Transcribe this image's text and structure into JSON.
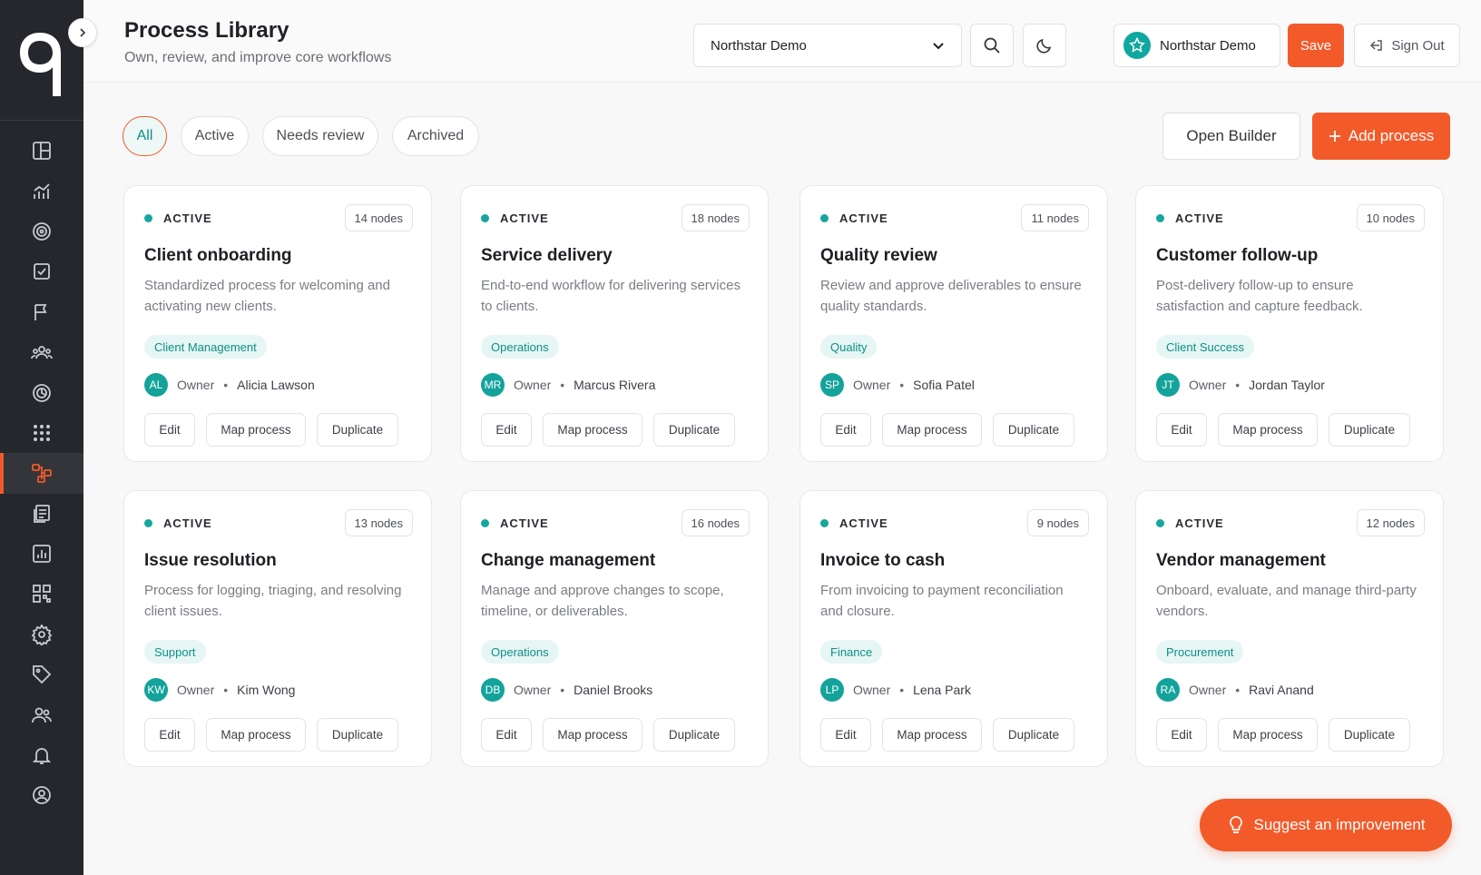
{
  "header": {
    "title": "Process Library",
    "subtitle": "Own, review, and improve core workflows",
    "workspace_select": "Northstar Demo",
    "org_name": "Northstar Demo",
    "save_label": "Save",
    "signout_label": "Sign Out"
  },
  "filters": [
    "All",
    "Active",
    "Needs review",
    "Archived"
  ],
  "active_filter": "All",
  "actions": {
    "open_builder": "Open Builder",
    "add_process": "Add process"
  },
  "sidebar": {
    "items": [
      {
        "icon": "dashboard-icon"
      },
      {
        "icon": "analytics-icon"
      },
      {
        "icon": "target-icon"
      },
      {
        "icon": "checklist-icon"
      },
      {
        "icon": "flag-icon"
      },
      {
        "icon": "team-icon"
      },
      {
        "icon": "goals-icon"
      },
      {
        "icon": "apps-icon"
      },
      {
        "icon": "process-icon",
        "active": true
      },
      {
        "icon": "documents-icon"
      },
      {
        "icon": "reports-icon"
      },
      {
        "icon": "integrations-icon"
      },
      {
        "icon": "settings-icon"
      },
      {
        "icon": "tag-icon"
      },
      {
        "icon": "users-icon"
      },
      {
        "icon": "bell-icon"
      },
      {
        "icon": "profile-icon"
      }
    ]
  },
  "card_actions": {
    "edit": "Edit",
    "map": "Map process",
    "duplicate": "Duplicate"
  },
  "owner_label": "Owner",
  "bullet": "•",
  "cards": [
    {
      "status": "ACTIVE",
      "nodes": "14 nodes",
      "name": "Client onboarding",
      "desc": "Standardized process for welcoming and activating new clients.",
      "tag": "Client Management",
      "initials": "AL",
      "owner": "Alicia Lawson"
    },
    {
      "status": "ACTIVE",
      "nodes": "18 nodes",
      "name": "Service delivery",
      "desc": "End-to-end workflow for delivering services to clients.",
      "tag": "Operations",
      "initials": "MR",
      "owner": "Marcus Rivera"
    },
    {
      "status": "ACTIVE",
      "nodes": "11 nodes",
      "name": "Quality review",
      "desc": "Review and approve deliverables to ensure quality standards.",
      "tag": "Quality",
      "initials": "SP",
      "owner": "Sofia Patel"
    },
    {
      "status": "ACTIVE",
      "nodes": "10 nodes",
      "name": "Customer follow-up",
      "desc": "Post-delivery follow-up to ensure satisfaction and capture feedback.",
      "tag": "Client Success",
      "initials": "JT",
      "owner": "Jordan Taylor"
    },
    {
      "status": "ACTIVE",
      "nodes": "13 nodes",
      "name": "Issue resolution",
      "desc": "Process for logging, triaging, and resolving client issues.",
      "tag": "Support",
      "initials": "KW",
      "owner": "Kim Wong"
    },
    {
      "status": "ACTIVE",
      "nodes": "16 nodes",
      "name": "Change management",
      "desc": "Manage and approve changes to scope, timeline, or deliverables.",
      "tag": "Operations",
      "initials": "DB",
      "owner": "Daniel Brooks"
    },
    {
      "status": "ACTIVE",
      "nodes": "9 nodes",
      "name": "Invoice to cash",
      "desc": "From invoicing to payment reconciliation and closure.",
      "tag": "Finance",
      "initials": "LP",
      "owner": "Lena Park"
    },
    {
      "status": "ACTIVE",
      "nodes": "12 nodes",
      "name": "Vendor management",
      "desc": "Onboard, evaluate, and manage third-party vendors.",
      "tag": "Procurement",
      "initials": "RA",
      "owner": "Ravi Anand"
    }
  ],
  "suggest_label": "Suggest an improvement",
  "colors": {
    "accent": "#f35a2a",
    "teal": "#13a39b",
    "sidebar": "#25272c"
  }
}
